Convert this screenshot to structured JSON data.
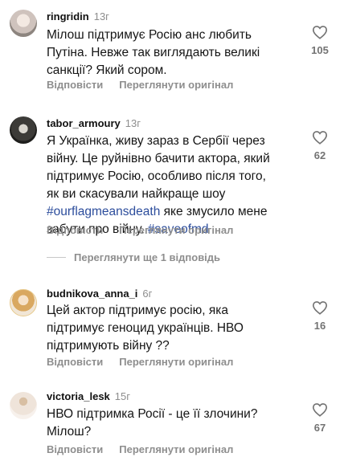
{
  "comments": [
    {
      "username": "ringridin",
      "time": "13г",
      "text": "Мілош підтримує Росію анс любить Путіна. Невже так виглядають великі санкції? Який сором.",
      "reply_label": "Відповісти",
      "view_original_label": "Переглянути оригінал",
      "likes": "105"
    },
    {
      "username": "tabor_armoury",
      "time": "13г",
      "text_before": "Я Українка, живу зараз в Сербії через війну. Це руйнівно бачити актора, який підтримує Росію, особливо після того, як ви скасували найкраще шоу ",
      "hashtag1": "#ourflagmeansdeath",
      "text_middle": " яке змусило мене забути про війну. ",
      "hashtag2": "#saveofmd",
      "reply_label": "Відповісти",
      "view_original_label": "Переглянути оригінал",
      "likes": "62",
      "view_replies_label": "Переглянути ще 1 відповідь"
    },
    {
      "username": "budnikova_anna_i",
      "time": "6г",
      "text": "Цей актор підтримує росію, яка підтримує геноцид українців. НВО підтримують війну ??",
      "reply_label": "Відповісти",
      "view_original_label": "Переглянути оригінал",
      "likes": "16"
    },
    {
      "username": "victoria_lesk",
      "time": "15г",
      "text": "НВО підтримка Росії - це її злочини? Мілош?",
      "reply_label": "Відповісти",
      "view_original_label": "Переглянути оригінал",
      "likes": "67"
    }
  ]
}
